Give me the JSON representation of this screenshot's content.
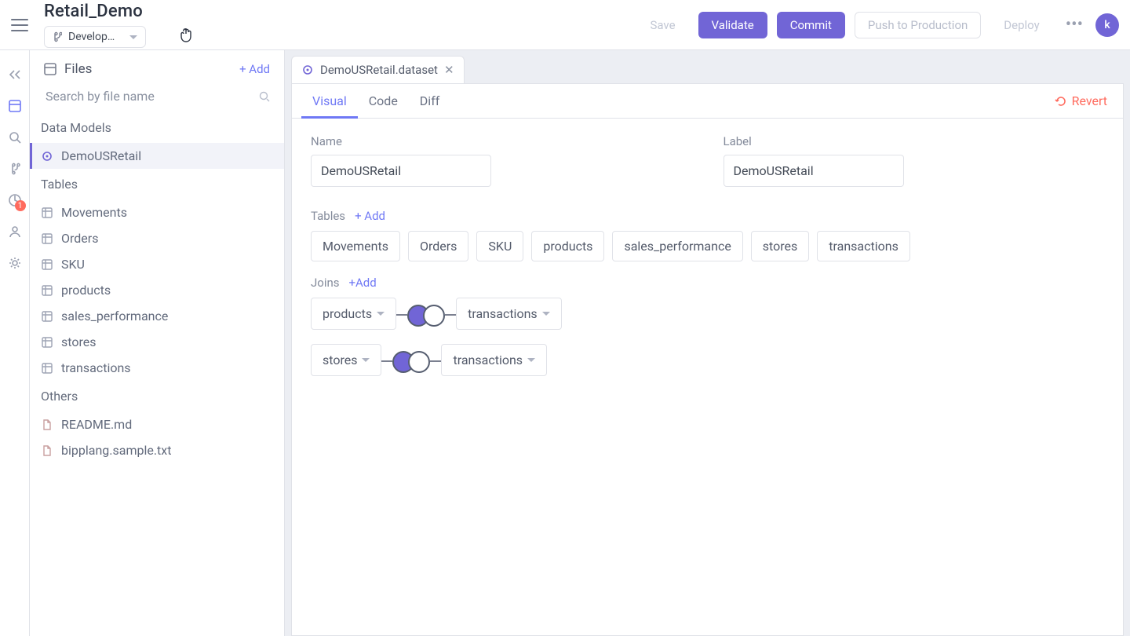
{
  "header": {
    "project_title": "Retail_Demo",
    "branch": "Developm…",
    "save": "Save",
    "validate": "Validate",
    "commit": "Commit",
    "push": "Push to Production",
    "deploy": "Deploy",
    "avatar_letter": "k"
  },
  "rail": {
    "badge": "1"
  },
  "files": {
    "title": "Files",
    "add": "+ Add",
    "search_placeholder": "Search by file name",
    "sections": {
      "data_models": "Data Models",
      "tables": "Tables",
      "others": "Others"
    },
    "data_models": [
      "DemoUSRetail"
    ],
    "tables": [
      "Movements",
      "Orders",
      "SKU",
      "products",
      "sales_performance",
      "stores",
      "transactions"
    ],
    "others": [
      "README.md",
      "bipplang.sample.txt"
    ]
  },
  "filetab": {
    "name": "DemoUSRetail.dataset"
  },
  "subtabs": {
    "visual": "Visual",
    "code": "Code",
    "diff": "Diff",
    "revert": "Revert"
  },
  "dataset": {
    "name_label": "Name",
    "name_value": "DemoUSRetail",
    "label_label": "Label",
    "label_value": "DemoUSRetail",
    "tables_label": "Tables",
    "tables_add": "+ Add",
    "table_chips": [
      "Movements",
      "Orders",
      "SKU",
      "products",
      "sales_performance",
      "stores",
      "transactions"
    ],
    "joins_label": "Joins",
    "joins_add": "+Add",
    "joins": [
      {
        "left": "products",
        "right": "transactions"
      },
      {
        "left": "stores",
        "right": "transactions"
      }
    ]
  }
}
